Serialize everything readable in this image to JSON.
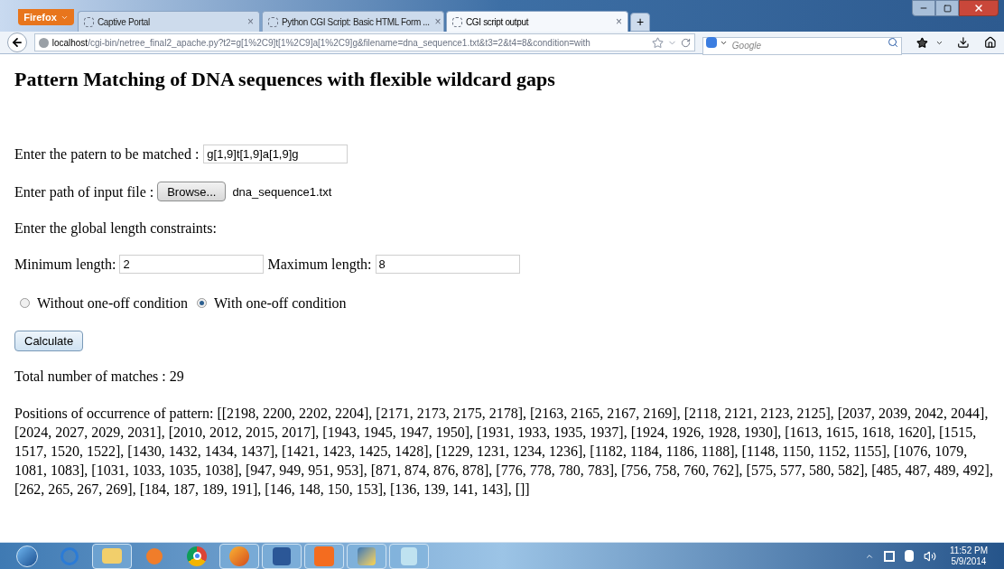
{
  "browser": {
    "menu_button": "Firefox",
    "tabs": [
      {
        "title": "Captive Portal",
        "selected": false,
        "close": "×"
      },
      {
        "title": "Python CGI Script: Basic HTML Form ...",
        "selected": false,
        "close": "×"
      },
      {
        "title": "CGI script output",
        "selected": true,
        "close": "×"
      }
    ],
    "new_tab": "+",
    "url_host": "localhost",
    "url_path": "/cgi-bin/netree_final2_apache.py?t2=g[1%2C9]t[1%2C9]a[1%2C9]g&filename=dna_sequence1.txt&t3=2&t4=8&condition=with",
    "search": {
      "placeholder": "Google"
    }
  },
  "page": {
    "heading": "Pattern Matching of DNA sequences with flexible wildcard gaps",
    "pattern_label": "Enter the patern to be matched :",
    "pattern_value": "g[1,9]t[1,9]a[1,9]g",
    "file_label": "Enter path of input file :",
    "browse_button": "Browse...",
    "file_name": "dna_sequence1.txt",
    "constraints_label": "Enter the global length constraints:",
    "min_label": "Minimum length:",
    "min_value": "2",
    "max_label": "Maximum length:",
    "max_value": "8",
    "conditions": [
      {
        "label": "Without one-off condition",
        "selected": false
      },
      {
        "label": "With one-off condition",
        "selected": true
      }
    ],
    "calculate_button": "Calculate",
    "total": "Total number of matches : 29",
    "positions": "Positions of occurrence of pattern: [[2198, 2200, 2202, 2204], [2171, 2173, 2175, 2178], [2163, 2165, 2167, 2169], [2118, 2121, 2123, 2125], [2037, 2039, 2042, 2044], [2024, 2027, 2029, 2031], [2010, 2012, 2015, 2017], [1943, 1945, 1947, 1950], [1931, 1933, 1935, 1937], [1924, 1926, 1928, 1930], [1613, 1615, 1618, 1620], [1515, 1517, 1520, 1522], [1430, 1432, 1434, 1437], [1421, 1423, 1425, 1428], [1229, 1231, 1234, 1236], [1182, 1184, 1186, 1188], [1148, 1150, 1152, 1155], [1076, 1079, 1081, 1083], [1031, 1033, 1035, 1038], [947, 949, 951, 953], [871, 874, 876, 878], [776, 778, 780, 783], [756, 758, 760, 762], [575, 577, 580, 582], [485, 487, 489, 492], [262, 265, 267, 269], [184, 187, 189, 191], [146, 148, 150, 153], [136, 139, 141, 143], []]"
  },
  "taskbar": {
    "time": "11:52 PM",
    "date": "5/9/2014"
  }
}
